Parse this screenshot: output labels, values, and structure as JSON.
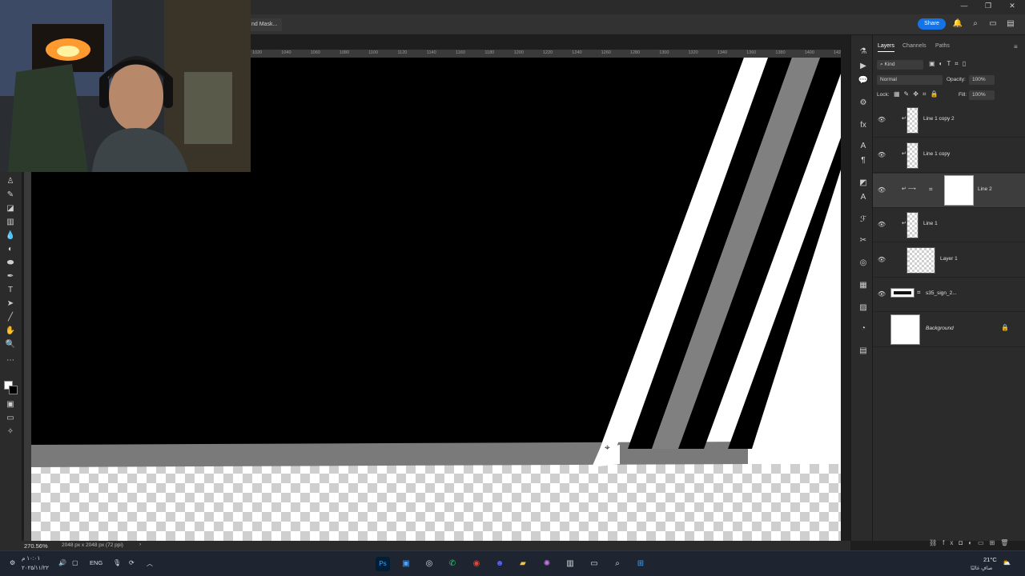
{
  "options_bar": {
    "mask_button_label": "nd Mask..."
  },
  "header": {
    "share_label": "Share"
  },
  "ruler": {
    "ticks": [
      "1020",
      "1040",
      "1060",
      "1080",
      "1100",
      "1120",
      "1140",
      "1160",
      "1180",
      "1200",
      "1220",
      "1240",
      "1260",
      "1280",
      "1300",
      "1320",
      "1340",
      "1360",
      "1380",
      "1400",
      "1420"
    ]
  },
  "panel": {
    "tabs": [
      "Layers",
      "Channels",
      "Paths"
    ],
    "filter_kind": "Kind",
    "blend_mode": "Normal",
    "opacity_label": "Opacity:",
    "opacity_value": "100%",
    "lock_label": "Lock:",
    "fill_label": "Fill:",
    "fill_value": "100%",
    "layers": [
      {
        "name": "Line 1 copy 2",
        "visible": true,
        "selected": false
      },
      {
        "name": "Line 1 copy",
        "visible": true,
        "selected": false
      },
      {
        "name": "Line 2",
        "visible": true,
        "selected": true
      },
      {
        "name": "Line 1",
        "visible": true,
        "selected": false
      },
      {
        "name": "Layer 1",
        "visible": true,
        "selected": false
      },
      {
        "name": "s35_sign_2...",
        "visible": true,
        "selected": false
      },
      {
        "name": "Background",
        "visible": false,
        "selected": false
      }
    ]
  },
  "status": {
    "zoom": "270.56%",
    "doc_info": "2048 px x 2048 px (72 ppi)"
  },
  "taskbar": {
    "language": "ENG",
    "clock_time": "١٠:٠١ م",
    "clock_date": "٢٠٢٥/١١/٢٢",
    "weather_temp": "21°C",
    "weather_desc": "صافٍ غالبًا"
  },
  "colors": {
    "accent": "#1473e6",
    "canvas_bg": "#000000",
    "stripe_gray": "#808080"
  }
}
